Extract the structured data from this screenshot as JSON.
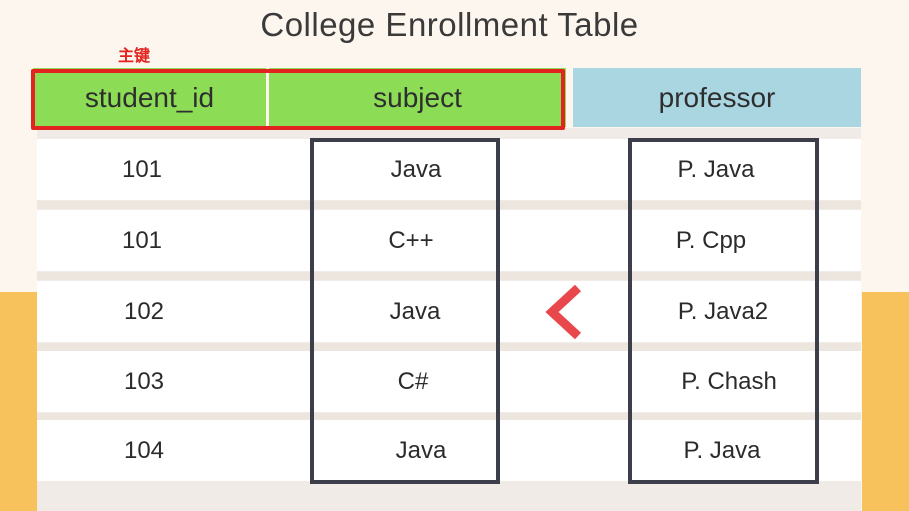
{
  "title": "College Enrollment Table",
  "primary_key_label": "主键",
  "headers": {
    "student_id": "student_id",
    "subject": "subject",
    "professor": "professor"
  },
  "rows": [
    {
      "student_id": "101",
      "subject": "Java",
      "professor": "P. Java"
    },
    {
      "student_id": "101",
      "subject": "C++",
      "professor": "P. Cpp"
    },
    {
      "student_id": "102",
      "subject": "Java",
      "professor": "P. Java2"
    },
    {
      "student_id": "103",
      "subject": "C#",
      "professor": "P. Chash"
    },
    {
      "student_id": "104",
      "subject": "Java",
      "professor": "P. Java"
    }
  ],
  "colors": {
    "key_header": "#8ddc56",
    "non_key_header": "#a9d6e0",
    "primary_key_outline": "#e3231f",
    "dependency_box": "#3c3f4a",
    "arrow": "#e8484b",
    "side_band": "#f7c15c"
  },
  "icons": {
    "arrow": "chevron-left-icon"
  }
}
